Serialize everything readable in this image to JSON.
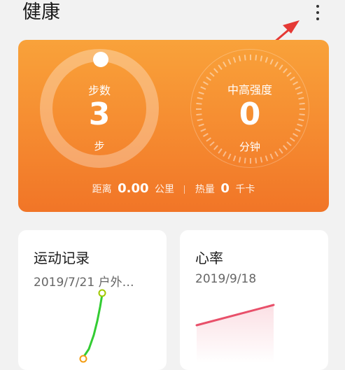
{
  "header": {
    "title": "健康",
    "more_icon": "more-vertical-icon"
  },
  "summary": {
    "steps": {
      "label": "步数",
      "value": "3",
      "unit": "步",
      "progress": 0.0
    },
    "intensity": {
      "label": "中高强度",
      "value": "0",
      "unit": "分钟"
    },
    "distance": {
      "label": "距离",
      "value": "0.00",
      "unit": "公里"
    },
    "calories": {
      "label": "热量",
      "value": "0",
      "unit": "千卡"
    }
  },
  "cards": {
    "workout": {
      "title": "运动记录",
      "subtitle": "2019/7/21 户外…"
    },
    "heart_rate": {
      "title": "心率",
      "subtitle": "2019/9/18"
    }
  },
  "colors": {
    "card_gradient_top": "#f9a23a",
    "card_gradient_bottom": "#f17527",
    "annotation_arrow": "#e53935",
    "route_line": "#33cc33",
    "heart_rate_line": "#e8506a"
  }
}
